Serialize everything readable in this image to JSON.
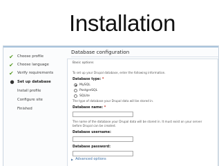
{
  "slide": {
    "title": "Installation"
  },
  "sidebar": {
    "steps": [
      {
        "label": "Choose profile",
        "state": "done"
      },
      {
        "label": "Choose language",
        "state": "done"
      },
      {
        "label": "Verify requirements",
        "state": "done"
      },
      {
        "label": "Set up database",
        "state": "active"
      },
      {
        "label": "Install profile",
        "state": "pending"
      },
      {
        "label": "Configure site",
        "state": "pending"
      },
      {
        "label": "Finished",
        "state": "pending"
      }
    ]
  },
  "main": {
    "heading": "Database configuration",
    "fieldset_legend": "Basic options",
    "intro_text": "To set up your Drupal database, enter the following information.",
    "db_type": {
      "label": "Database type:",
      "required_mark": "*",
      "options": [
        "MySQL",
        "PostgreSQL",
        "SQLite"
      ],
      "selected": "MySQL",
      "help": "The type of database your Drupal data will be stored in."
    },
    "db_name": {
      "label": "Database name:",
      "required_mark": "*",
      "value": "",
      "help_line1": "The name of the database your Drupal data will be stored in. It must exist on your server",
      "help_line2": "before Drupal can be created."
    },
    "db_username": {
      "label": "Database username:",
      "value": ""
    },
    "db_password": {
      "label": "Database password:",
      "value": ""
    },
    "advanced": {
      "label": "Advanced options"
    }
  },
  "colors": {
    "accent": "#a9c4dc",
    "check": "#5a9c2a",
    "link": "#3a6ea5",
    "required": "#c0392b"
  }
}
